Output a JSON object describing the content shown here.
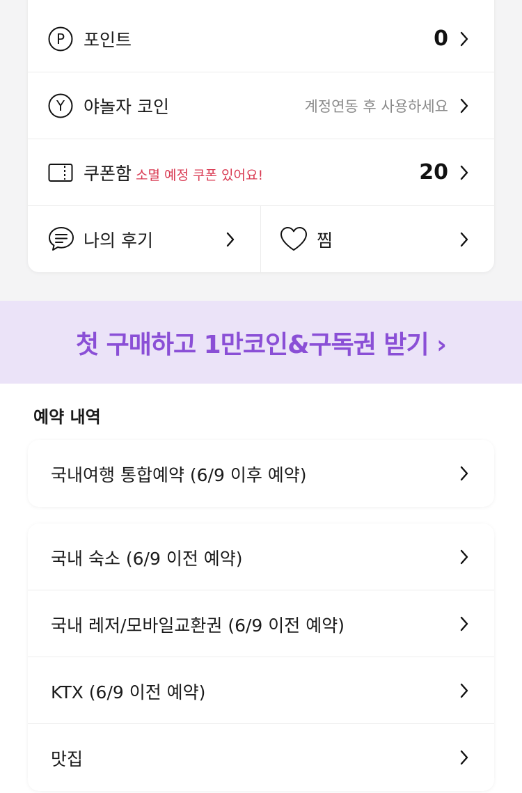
{
  "account_rows": [
    {
      "icon": "p-circle-icon",
      "label": "포인트",
      "value": "0"
    },
    {
      "icon": "y-circle-icon",
      "label": "야놀자 코인",
      "value": "계정연동 후 사용하세요"
    },
    {
      "icon": "coupon-icon",
      "label": "쿠폰함",
      "warning": "소멸 예정 쿠폰 있어요!",
      "value": "20"
    }
  ],
  "split_row": {
    "left": {
      "icon": "chat-icon",
      "label": "나의 후기"
    },
    "right": {
      "icon": "heart-icon",
      "label": "찜"
    }
  },
  "banner": {
    "text": "첫 구매하고 1만코인&구독권 받기 ›"
  },
  "reservations": {
    "title": "예약 내역",
    "primary": "국내여행 통합예약 (6/9 이후 예약)",
    "legacy": [
      "국내 숙소 (6/9 이전 예약)",
      "국내 레저/모바일교환권 (6/9 이전 예약)",
      "KTX (6/9 이전 예약)",
      "맛집"
    ]
  },
  "colors": {
    "accent": "#8a4fd6",
    "banner_bg": "#ebe3f8",
    "warning": "#d93a52"
  }
}
